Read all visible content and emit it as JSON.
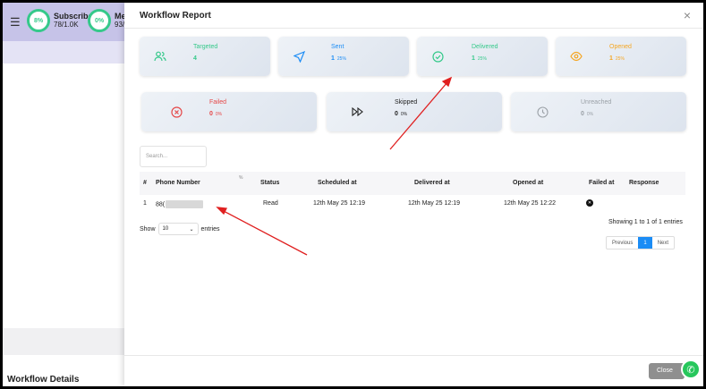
{
  "background": {
    "stats": [
      {
        "percent": "8%",
        "label": "Subscriber",
        "value": "78/1.0K"
      },
      {
        "percent": "0%",
        "label": "Mes",
        "value": "93/0"
      }
    ],
    "footer_title": "Workflow Details"
  },
  "modal": {
    "title": "Workflow Report",
    "close_x": "×",
    "cards": [
      {
        "label": "Targeted",
        "value": "4",
        "percent": "",
        "color": "#35c98a"
      },
      {
        "label": "Sent",
        "value": "1",
        "percent": "25%",
        "color": "#1b8cf5"
      },
      {
        "label": "Delivered",
        "value": "1",
        "percent": "25%",
        "color": "#35c98a"
      },
      {
        "label": "Opened",
        "value": "1",
        "percent": "25%",
        "color": "#f5a623"
      },
      {
        "label": "Failed",
        "value": "0",
        "percent": "0%",
        "color": "#e54848"
      },
      {
        "label": "Skipped",
        "value": "0",
        "percent": "0%",
        "color": "#222222"
      },
      {
        "label": "Unreached",
        "value": "0",
        "percent": "0%",
        "color": "#9aa0a6"
      }
    ],
    "search_placeholder": "Search...",
    "table": {
      "headers": [
        "#",
        "Phone Number",
        "%",
        "Status",
        "Scheduled at",
        "Delivered at",
        "Opened at",
        "Failed at",
        "Response"
      ],
      "rows": [
        {
          "index": "1",
          "phone": "88(",
          "status": "Read",
          "scheduled": "12th May 25 12:19",
          "delivered": "12th May 25 12:19",
          "opened": "12th May 25 12:22",
          "failed": "",
          "response": ""
        }
      ]
    },
    "show_label": "Show",
    "entries_value": "10",
    "entries_label": "entries",
    "info": "Showing 1 to 1 of 1 entries",
    "pager": {
      "prev": "Previous",
      "current": "1",
      "next": "Next"
    },
    "close_label": "Close"
  }
}
